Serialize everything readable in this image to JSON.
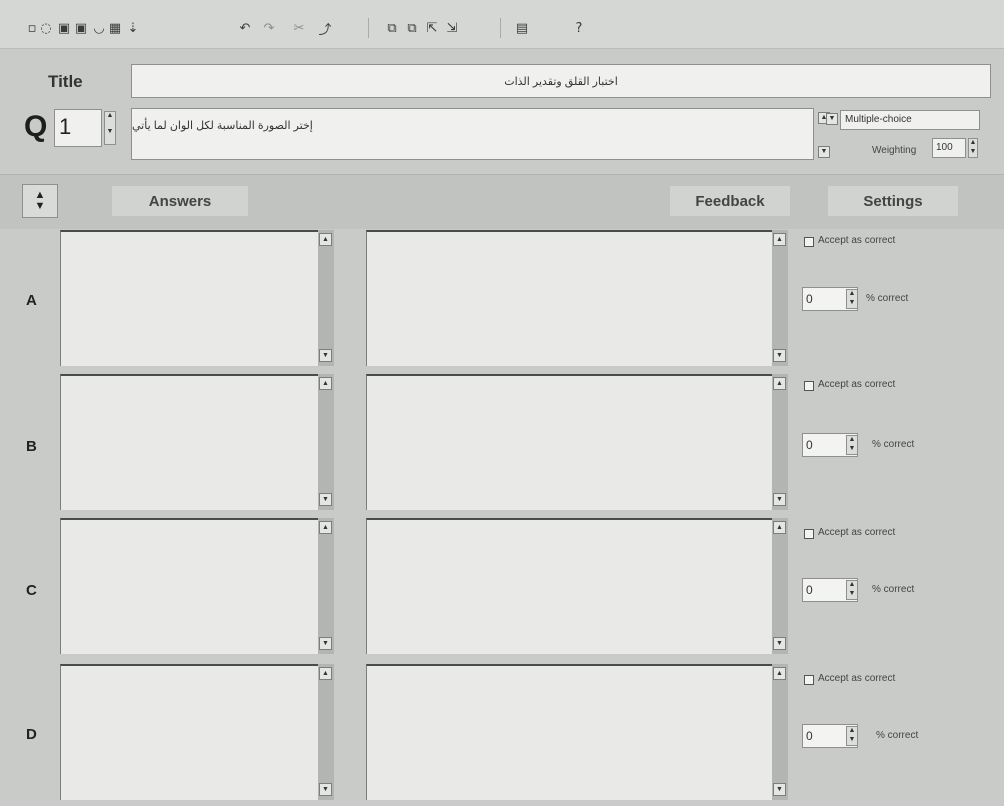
{
  "toolbar": {
    "icons": [
      "new-icon",
      "open-icon",
      "save-icon",
      "save-as-icon",
      "open-alt-icon",
      "export-icon",
      "insert-icon",
      "undo-icon",
      "redo-icon",
      "cut-icon",
      "paste-icon",
      "copy-icon",
      "copy-alt-icon",
      "move-icon",
      "move-alt-icon",
      "preview-icon",
      "help-icon"
    ],
    "help_label": "?"
  },
  "title_row": {
    "label": "Title",
    "value": "اختبار القلق وتقدير الذات"
  },
  "question": {
    "label": "Q",
    "number": "1",
    "text": "إختر الصورة المناسبة لكل الوان لما يأتي",
    "type": "Multiple-choice",
    "weighting_label": "Weighting",
    "weighting": "100"
  },
  "headers": {
    "answers": "Answers",
    "feedback": "Feedback",
    "settings": "Settings"
  },
  "rows": [
    {
      "letter": "A",
      "accept_label": "Accept as correct",
      "percent": "0",
      "percent_label": "% correct"
    },
    {
      "letter": "B",
      "accept_label": "Accept as correct",
      "percent": "0",
      "percent_label": "% correct"
    },
    {
      "letter": "C",
      "accept_label": "Accept as correct",
      "percent": "0",
      "percent_label": "% correct"
    },
    {
      "letter": "D",
      "accept_label": "Accept as correct",
      "percent": "0",
      "percent_label": "% correct"
    }
  ]
}
